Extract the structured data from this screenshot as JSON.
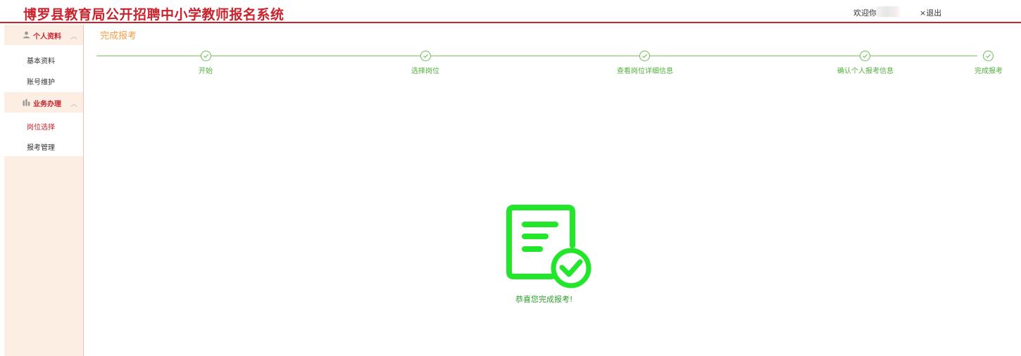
{
  "header": {
    "title": "博罗县教育局公开招聘中小学教师报名系统",
    "welcome": "欢迎你!",
    "logout": "×退出"
  },
  "sidebar": {
    "groups": [
      {
        "label": "个人资料",
        "icon": "user-icon",
        "items": [
          {
            "label": "基本资料",
            "active": false
          },
          {
            "label": "账号维护",
            "active": false
          }
        ]
      },
      {
        "label": "业务办理",
        "icon": "chart-icon",
        "items": [
          {
            "label": "岗位选择",
            "active": true
          },
          {
            "label": "报考管理",
            "active": false
          }
        ]
      }
    ]
  },
  "page": {
    "heading": "完成报考"
  },
  "steps": [
    {
      "label": "开始",
      "done": true
    },
    {
      "label": "选择岗位",
      "done": true
    },
    {
      "label": "查看岗位详细信息",
      "done": true
    },
    {
      "label": "确认个人报考信息",
      "done": true
    },
    {
      "label": "完成报考",
      "done": true
    }
  ],
  "result": {
    "icon": "document-check-icon",
    "message": "恭喜您完成报考!"
  },
  "colors": {
    "brand_red": "#c8232c",
    "heading_orange": "#f0a04b",
    "step_green": "#52b03b",
    "success_green": "#22e62a",
    "sidebar_bg": "#fdeee4"
  }
}
